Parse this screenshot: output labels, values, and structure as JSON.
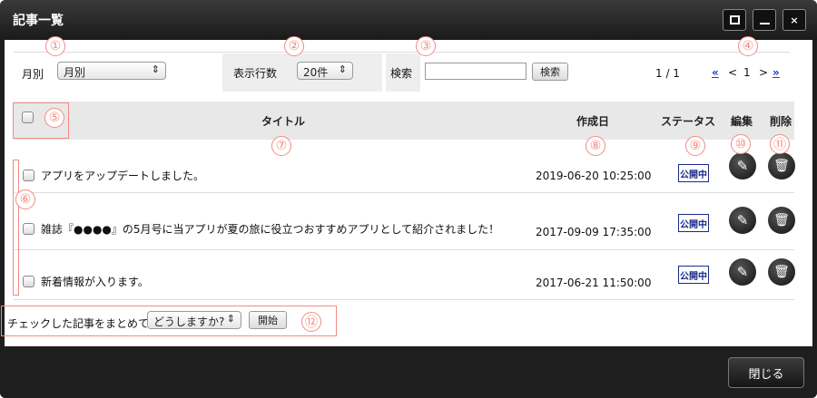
{
  "window": {
    "title": "記事一覧"
  },
  "filters": {
    "month_label": "月別",
    "month_value": "月別",
    "rows_label": "表示行数",
    "rows_value": "20件",
    "search_label": "検索",
    "search_value": "",
    "search_button": "検索"
  },
  "pagination": {
    "page_info": "1 / 1",
    "first": "«",
    "prev": "<",
    "current": "1",
    "next": ">",
    "last": "»"
  },
  "table": {
    "headers": {
      "title": "タイトル",
      "date": "作成日",
      "status": "ステータス",
      "edit": "編集",
      "delete": "削除"
    },
    "rows": [
      {
        "title": "アプリをアップデートしました。",
        "date": "2019-06-20 10:25:00",
        "status": "公開中"
      },
      {
        "title": "雑誌『●●●●』の5月号に当アプリが夏の旅に役立つおすすめアプリとして紹介されました！",
        "date": "2017-09-09 17:35:00",
        "status": "公開中"
      },
      {
        "title": "新着情報が入ります。",
        "date": "2017-06-21 11:50:00",
        "status": "公開中"
      }
    ]
  },
  "bulk": {
    "label": "チェックした記事をまとめて",
    "select_value": "どうしますか?",
    "start_button": "開始"
  },
  "footer": {
    "close_button": "閉じる"
  },
  "callouts": [
    "①",
    "②",
    "③",
    "④",
    "⑤",
    "⑥",
    "⑦",
    "⑧",
    "⑨",
    "⑩",
    "⑪",
    "⑫"
  ]
}
